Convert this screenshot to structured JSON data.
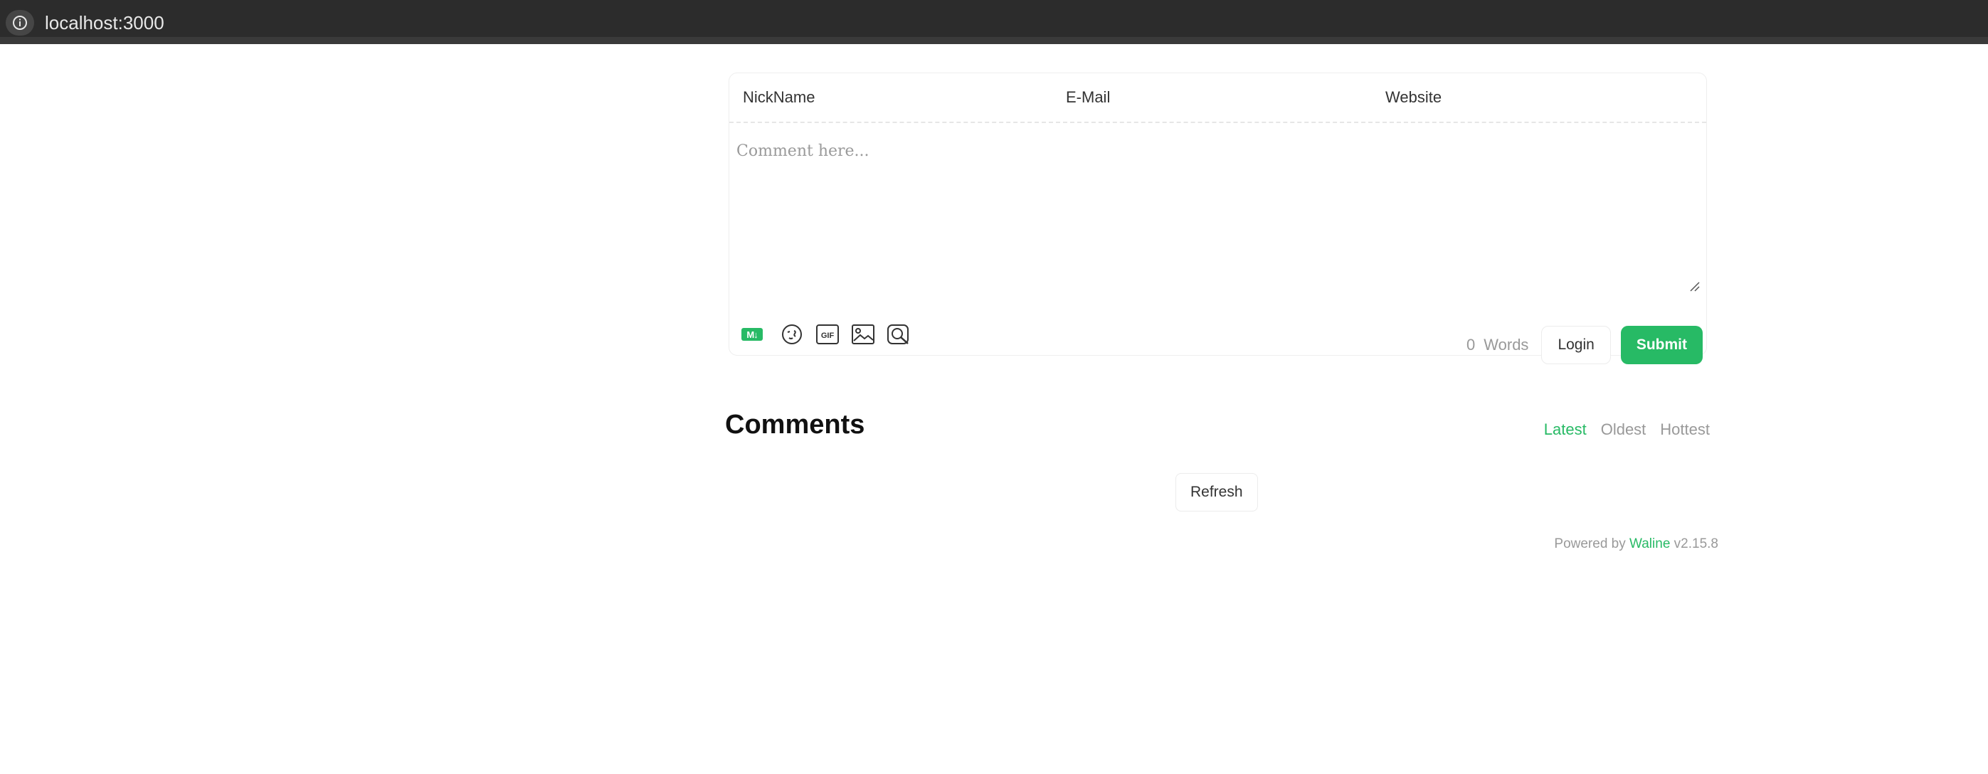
{
  "browser": {
    "url": "localhost:3000",
    "info_icon": "info-icon"
  },
  "form": {
    "nickname_label": "NickName",
    "email_label": "E-Mail",
    "website_label": "Website",
    "comment_placeholder": "Comment here...",
    "toolbar": {
      "markdown_badge": "M↓",
      "icons": [
        "markdown-icon",
        "emoji-icon",
        "gif-icon",
        "image-icon",
        "preview-icon"
      ]
    },
    "word_count": "0",
    "word_label": "Words",
    "login_label": "Login",
    "submit_label": "Submit"
  },
  "comments": {
    "title": "Comments",
    "sort": {
      "latest": "Latest",
      "oldest": "Oldest",
      "hottest": "Hottest",
      "active": "latest"
    },
    "refresh_label": "Refresh"
  },
  "powered": {
    "prefix": "Powered by",
    "brand": "Waline",
    "version": "v2.15.8"
  },
  "colors": {
    "accent": "#27ba65",
    "muted": "#999999",
    "browser_bar": "#2c2c2c"
  }
}
